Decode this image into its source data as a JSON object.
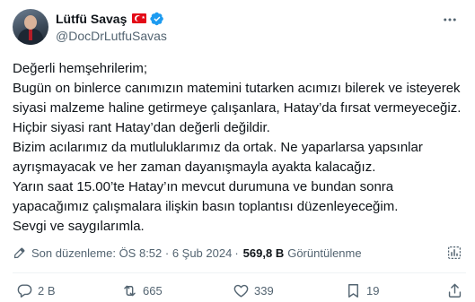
{
  "author": {
    "display_name": "Lütfü Savaş",
    "handle": "@DocDrLutfuSavas",
    "flag_icon": "turkey-flag-icon",
    "verified_icon": "verified-badge-icon",
    "verified_color": "#1d9bf0"
  },
  "tweet": {
    "text": "Değerli hemşehrilerim;\nBugün on binlerce canımızın matemini tutarken acımızı bilerek ve isteyerek siyasi malzeme haline getirmeye çalışanlara, Hatay’da fırsat vermeyeceğiz. Hiçbir siyasi rant Hatay’dan değerli değildir.\nBizim acılarımız da mutluluklarımız da ortak. Ne yaparlarsa yapsınlar ayrışmayacak ve her zaman dayanışmayla ayakta kalacağız.\nYarın saat 15.00’te Hatay’ın mevcut durumuna ve bundan sonra yapacağımız çalışmalara ilişkin basın toplantısı düzenleyeceğim.\nSevgi ve saygılarımla."
  },
  "meta": {
    "edited_label": "Son düzenleme: ÖS 8:52 · 6 Şub 2024",
    "separator": "·",
    "views_count": "569,8 B",
    "views_label": "Görüntülenme"
  },
  "actions": {
    "reply_count": "2 B",
    "retweet_count": "665",
    "like_count": "339",
    "bookmark_count": "19"
  },
  "icons": {
    "more": "more-dots-icon",
    "edit": "pencil-icon",
    "analytics": "analytics-icon",
    "reply": "reply-icon",
    "retweet": "retweet-icon",
    "like": "heart-icon",
    "bookmark": "bookmark-icon",
    "share": "share-icon"
  },
  "colors": {
    "text": "#0f1419",
    "secondary": "#536471",
    "flag_red": "#e30a17"
  }
}
